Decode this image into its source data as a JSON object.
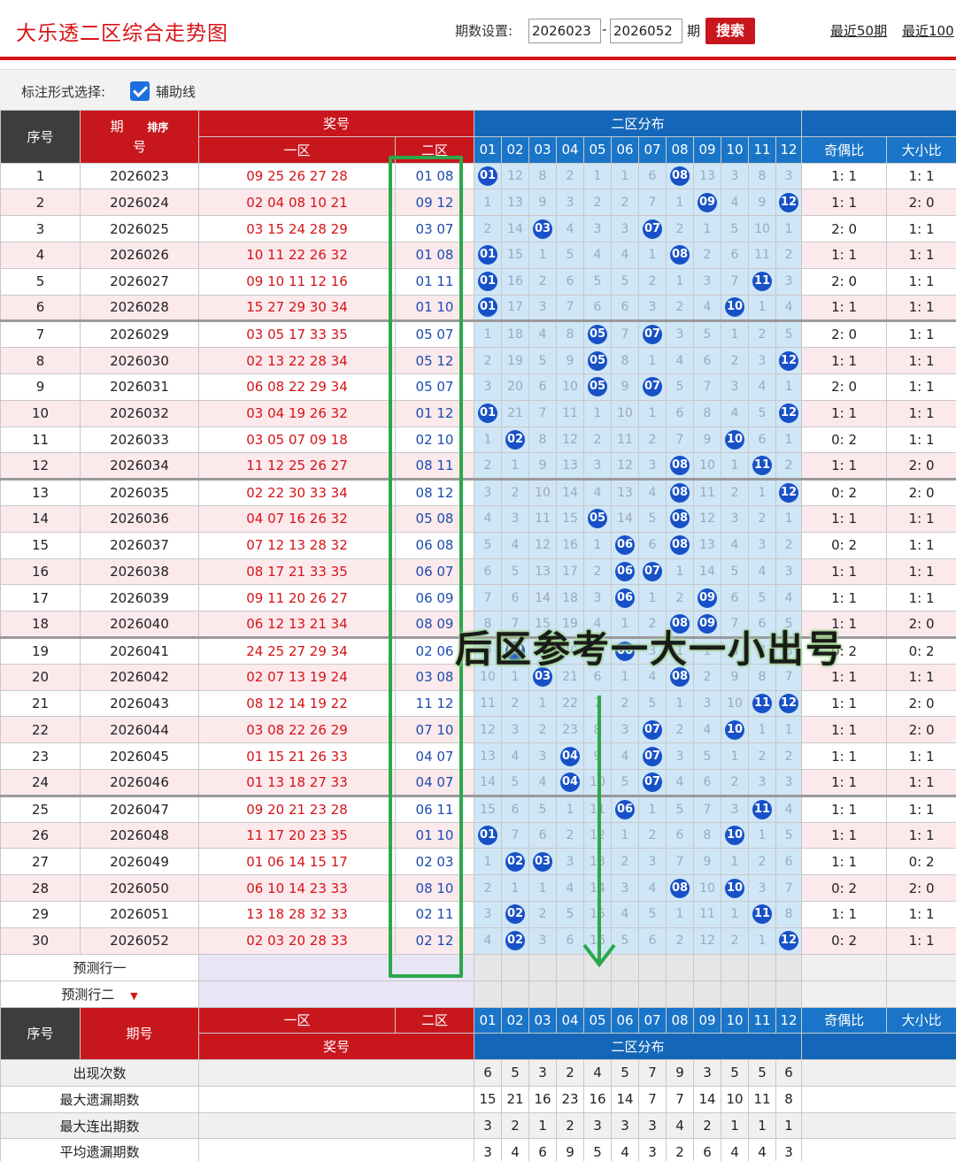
{
  "header": {
    "title": "大乐透二区综合走势图",
    "period_label": "期数设置:",
    "period_start": "2026023",
    "dash": "-",
    "period_end": "2026052",
    "period_unit": "期",
    "search_label": "搜索",
    "link_50": "最近50期",
    "link_100": "最近100"
  },
  "options": {
    "label": "标注形式选择:",
    "checkbox_label": "辅助线",
    "checked": true
  },
  "table_head": {
    "seq": "序号",
    "period": "期号",
    "period_top": "期",
    "period_bottom": "号",
    "sort": "排序",
    "prize": "奖号",
    "zone1": "一区",
    "zone2": "二区",
    "dist": "二区分布",
    "odd_even": "奇偶比",
    "big_small": "大小比",
    "nums": [
      "01",
      "02",
      "03",
      "04",
      "05",
      "06",
      "07",
      "08",
      "09",
      "10",
      "11",
      "12"
    ]
  },
  "rows": [
    {
      "seq": "1",
      "period": "2026023",
      "z1": "09 25 26 27 28",
      "z2": "01 08",
      "dist": [
        "B",
        "12",
        "8",
        "2",
        "1",
        "1",
        "6",
        "B",
        "13",
        "3",
        "8",
        "3"
      ],
      "oe": "1: 1",
      "bs": "1: 1"
    },
    {
      "seq": "2",
      "period": "2026024",
      "z1": "02 04 08 10 21",
      "z2": "09 12",
      "dist": [
        "1",
        "13",
        "9",
        "3",
        "2",
        "2",
        "7",
        "1",
        "B",
        "4",
        "9",
        "B"
      ],
      "oe": "1: 1",
      "bs": "2: 0"
    },
    {
      "seq": "3",
      "period": "2026025",
      "z1": "03 15 24 28 29",
      "z2": "03 07",
      "dist": [
        "2",
        "14",
        "B",
        "4",
        "3",
        "3",
        "B",
        "2",
        "1",
        "5",
        "10",
        "1"
      ],
      "oe": "2: 0",
      "bs": "1: 1"
    },
    {
      "seq": "4",
      "period": "2026026",
      "z1": "10 11 22 26 32",
      "z2": "01 08",
      "dist": [
        "B",
        "15",
        "1",
        "5",
        "4",
        "4",
        "1",
        "B",
        "2",
        "6",
        "11",
        "2"
      ],
      "oe": "1: 1",
      "bs": "1: 1"
    },
    {
      "seq": "5",
      "period": "2026027",
      "z1": "09 10 11 12 16",
      "z2": "01 11",
      "dist": [
        "B",
        "16",
        "2",
        "6",
        "5",
        "5",
        "2",
        "1",
        "3",
        "7",
        "B",
        "3"
      ],
      "oe": "2: 0",
      "bs": "1: 1"
    },
    {
      "seq": "6",
      "period": "2026028",
      "z1": "15 27 29 30 34",
      "z2": "01 10",
      "dist": [
        "B",
        "17",
        "3",
        "7",
        "6",
        "6",
        "3",
        "2",
        "4",
        "B",
        "1",
        "4"
      ],
      "oe": "1: 1",
      "bs": "1: 1"
    },
    {
      "seq": "7",
      "period": "2026029",
      "z1": "03 05 17 33 35",
      "z2": "05 07",
      "dist": [
        "1",
        "18",
        "4",
        "8",
        "B",
        "7",
        "B",
        "3",
        "5",
        "1",
        "2",
        "5"
      ],
      "oe": "2: 0",
      "bs": "1: 1"
    },
    {
      "seq": "8",
      "period": "2026030",
      "z1": "02 13 22 28 34",
      "z2": "05 12",
      "dist": [
        "2",
        "19",
        "5",
        "9",
        "B",
        "8",
        "1",
        "4",
        "6",
        "2",
        "3",
        "B"
      ],
      "oe": "1: 1",
      "bs": "1: 1"
    },
    {
      "seq": "9",
      "period": "2026031",
      "z1": "06 08 22 29 34",
      "z2": "05 07",
      "dist": [
        "3",
        "20",
        "6",
        "10",
        "B",
        "9",
        "B",
        "5",
        "7",
        "3",
        "4",
        "1"
      ],
      "oe": "2: 0",
      "bs": "1: 1"
    },
    {
      "seq": "10",
      "period": "2026032",
      "z1": "03 04 19 26 32",
      "z2": "01 12",
      "dist": [
        "B",
        "21",
        "7",
        "11",
        "1",
        "10",
        "1",
        "6",
        "8",
        "4",
        "5",
        "B"
      ],
      "oe": "1: 1",
      "bs": "1: 1"
    },
    {
      "seq": "11",
      "period": "2026033",
      "z1": "03 05 07 09 18",
      "z2": "02 10",
      "dist": [
        "1",
        "B",
        "8",
        "12",
        "2",
        "11",
        "2",
        "7",
        "9",
        "B",
        "6",
        "1"
      ],
      "oe": "0: 2",
      "bs": "1: 1"
    },
    {
      "seq": "12",
      "period": "2026034",
      "z1": "11 12 25 26 27",
      "z2": "08 11",
      "dist": [
        "2",
        "1",
        "9",
        "13",
        "3",
        "12",
        "3",
        "B",
        "10",
        "1",
        "B",
        "2"
      ],
      "oe": "1: 1",
      "bs": "2: 0"
    },
    {
      "seq": "13",
      "period": "2026035",
      "z1": "02 22 30 33 34",
      "z2": "08 12",
      "dist": [
        "3",
        "2",
        "10",
        "14",
        "4",
        "13",
        "4",
        "B",
        "11",
        "2",
        "1",
        "B"
      ],
      "oe": "0: 2",
      "bs": "2: 0"
    },
    {
      "seq": "14",
      "period": "2026036",
      "z1": "04 07 16 26 32",
      "z2": "05 08",
      "dist": [
        "4",
        "3",
        "11",
        "15",
        "B",
        "14",
        "5",
        "B",
        "12",
        "3",
        "2",
        "1"
      ],
      "oe": "1: 1",
      "bs": "1: 1"
    },
    {
      "seq": "15",
      "period": "2026037",
      "z1": "07 12 13 28 32",
      "z2": "06 08",
      "dist": [
        "5",
        "4",
        "12",
        "16",
        "1",
        "B",
        "6",
        "B",
        "13",
        "4",
        "3",
        "2"
      ],
      "oe": "0: 2",
      "bs": "1: 1"
    },
    {
      "seq": "16",
      "period": "2026038",
      "z1": "08 17 21 33 35",
      "z2": "06 07",
      "dist": [
        "6",
        "5",
        "13",
        "17",
        "2",
        "B",
        "B",
        "1",
        "14",
        "5",
        "4",
        "3"
      ],
      "oe": "1: 1",
      "bs": "1: 1"
    },
    {
      "seq": "17",
      "period": "2026039",
      "z1": "09 11 20 26 27",
      "z2": "06 09",
      "dist": [
        "7",
        "6",
        "14",
        "18",
        "3",
        "B",
        "1",
        "2",
        "B",
        "6",
        "5",
        "4"
      ],
      "oe": "1: 1",
      "bs": "1: 1"
    },
    {
      "seq": "18",
      "period": "2026040",
      "z1": "06 12 13 21 34",
      "z2": "08 09",
      "dist": [
        "8",
        "7",
        "15",
        "19",
        "4",
        "1",
        "2",
        "B",
        "B",
        "7",
        "6",
        "5"
      ],
      "oe": "1: 1",
      "bs": "2: 0"
    },
    {
      "seq": "19",
      "period": "2026041",
      "z1": "24 25 27 29 34",
      "z2": "02 06",
      "dist": [
        "9",
        "B",
        "16",
        "20",
        "5",
        "B",
        "3",
        "1",
        "1",
        "8",
        "7",
        "6"
      ],
      "oe": "0: 2",
      "bs": "0: 2"
    },
    {
      "seq": "20",
      "period": "2026042",
      "z1": "02 07 13 19 24",
      "z2": "03 08",
      "dist": [
        "10",
        "1",
        "B",
        "21",
        "6",
        "1",
        "4",
        "B",
        "2",
        "9",
        "8",
        "7"
      ],
      "oe": "1: 1",
      "bs": "1: 1"
    },
    {
      "seq": "21",
      "period": "2026043",
      "z1": "08 12 14 19 22",
      "z2": "11 12",
      "dist": [
        "11",
        "2",
        "1",
        "22",
        "7",
        "2",
        "5",
        "1",
        "3",
        "10",
        "B",
        "B"
      ],
      "oe": "1: 1",
      "bs": "2: 0"
    },
    {
      "seq": "22",
      "period": "2026044",
      "z1": "03 08 22 26 29",
      "z2": "07 10",
      "dist": [
        "12",
        "3",
        "2",
        "23",
        "8",
        "3",
        "B",
        "2",
        "4",
        "B",
        "1",
        "1"
      ],
      "oe": "1: 1",
      "bs": "2: 0"
    },
    {
      "seq": "23",
      "period": "2026045",
      "z1": "01 15 21 26 33",
      "z2": "04 07",
      "dist": [
        "13",
        "4",
        "3",
        "B",
        "9",
        "4",
        "B",
        "3",
        "5",
        "1",
        "2",
        "2"
      ],
      "oe": "1: 1",
      "bs": "1: 1"
    },
    {
      "seq": "24",
      "period": "2026046",
      "z1": "01 13 18 27 33",
      "z2": "04 07",
      "dist": [
        "14",
        "5",
        "4",
        "B",
        "10",
        "5",
        "B",
        "4",
        "6",
        "2",
        "3",
        "3"
      ],
      "oe": "1: 1",
      "bs": "1: 1"
    },
    {
      "seq": "25",
      "period": "2026047",
      "z1": "09 20 21 23 28",
      "z2": "06 11",
      "dist": [
        "15",
        "6",
        "5",
        "1",
        "11",
        "B",
        "1",
        "5",
        "7",
        "3",
        "B",
        "4"
      ],
      "oe": "1: 1",
      "bs": "1: 1"
    },
    {
      "seq": "26",
      "period": "2026048",
      "z1": "11 17 20 23 35",
      "z2": "01 10",
      "dist": [
        "B",
        "7",
        "6",
        "2",
        "12",
        "1",
        "2",
        "6",
        "8",
        "B",
        "1",
        "5"
      ],
      "oe": "1: 1",
      "bs": "1: 1"
    },
    {
      "seq": "27",
      "period": "2026049",
      "z1": "01 06 14 15 17",
      "z2": "02 03",
      "dist": [
        "1",
        "B",
        "B",
        "3",
        "13",
        "2",
        "3",
        "7",
        "9",
        "1",
        "2",
        "6"
      ],
      "oe": "1: 1",
      "bs": "0: 2"
    },
    {
      "seq": "28",
      "period": "2026050",
      "z1": "06 10 14 23 33",
      "z2": "08 10",
      "dist": [
        "2",
        "1",
        "1",
        "4",
        "14",
        "3",
        "4",
        "B",
        "10",
        "B",
        "3",
        "7"
      ],
      "oe": "0: 2",
      "bs": "2: 0"
    },
    {
      "seq": "29",
      "period": "2026051",
      "z1": "13 18 28 32 33",
      "z2": "02 11",
      "dist": [
        "3",
        "B",
        "2",
        "5",
        "15",
        "4",
        "5",
        "1",
        "11",
        "1",
        "B",
        "8"
      ],
      "oe": "1: 1",
      "bs": "1: 1"
    },
    {
      "seq": "30",
      "period": "2026052",
      "z1": "02 03 20 28 33",
      "z2": "02 12",
      "dist": [
        "4",
        "B",
        "3",
        "6",
        "16",
        "5",
        "6",
        "2",
        "12",
        "2",
        "1",
        "B"
      ],
      "oe": "0: 2",
      "bs": "1: 1"
    }
  ],
  "predict": {
    "row1": "预测行一",
    "row2": "预测行二"
  },
  "stats": [
    {
      "label": "出现次数",
      "values": [
        "6",
        "5",
        "3",
        "2",
        "4",
        "5",
        "7",
        "9",
        "3",
        "5",
        "5",
        "6"
      ]
    },
    {
      "label": "最大遗漏期数",
      "values": [
        "15",
        "21",
        "16",
        "23",
        "16",
        "14",
        "7",
        "7",
        "14",
        "10",
        "11",
        "8"
      ]
    },
    {
      "label": "最大连出期数",
      "values": [
        "3",
        "2",
        "1",
        "2",
        "3",
        "3",
        "3",
        "4",
        "2",
        "1",
        "1",
        "1"
      ]
    },
    {
      "label": "平均遗漏期数",
      "values": [
        "3",
        "4",
        "6",
        "9",
        "5",
        "4",
        "3",
        "2",
        "6",
        "4",
        "4",
        "3"
      ]
    }
  ],
  "annotation": {
    "text": "后区参考一大一小出号",
    "color": "#2aa84a"
  }
}
